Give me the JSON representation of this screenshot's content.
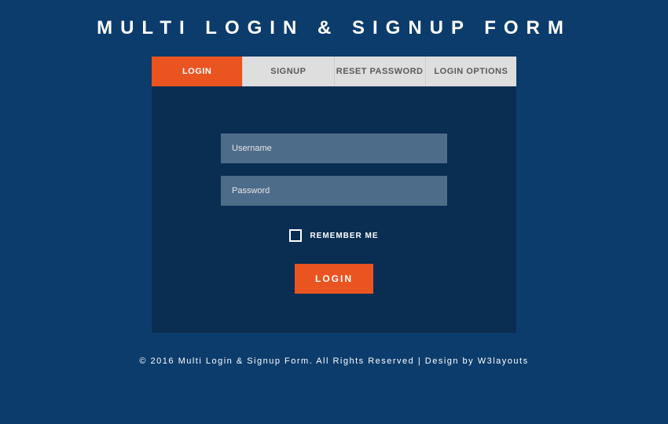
{
  "title": "MULTI LOGIN & SIGNUP FORM",
  "tabs": [
    {
      "label": "LOGIN"
    },
    {
      "label": "SIGNUP"
    },
    {
      "label": "RESET PASSWORD"
    },
    {
      "label": "LOGIN OPTIONS"
    }
  ],
  "form": {
    "username_placeholder": "Username",
    "password_placeholder": "Password",
    "remember_label": "REMEMBER ME",
    "submit_label": "LOGIN"
  },
  "footer": "© 2016 Multi Login & Signup Form. All Rights Reserved | Design by W3layouts"
}
